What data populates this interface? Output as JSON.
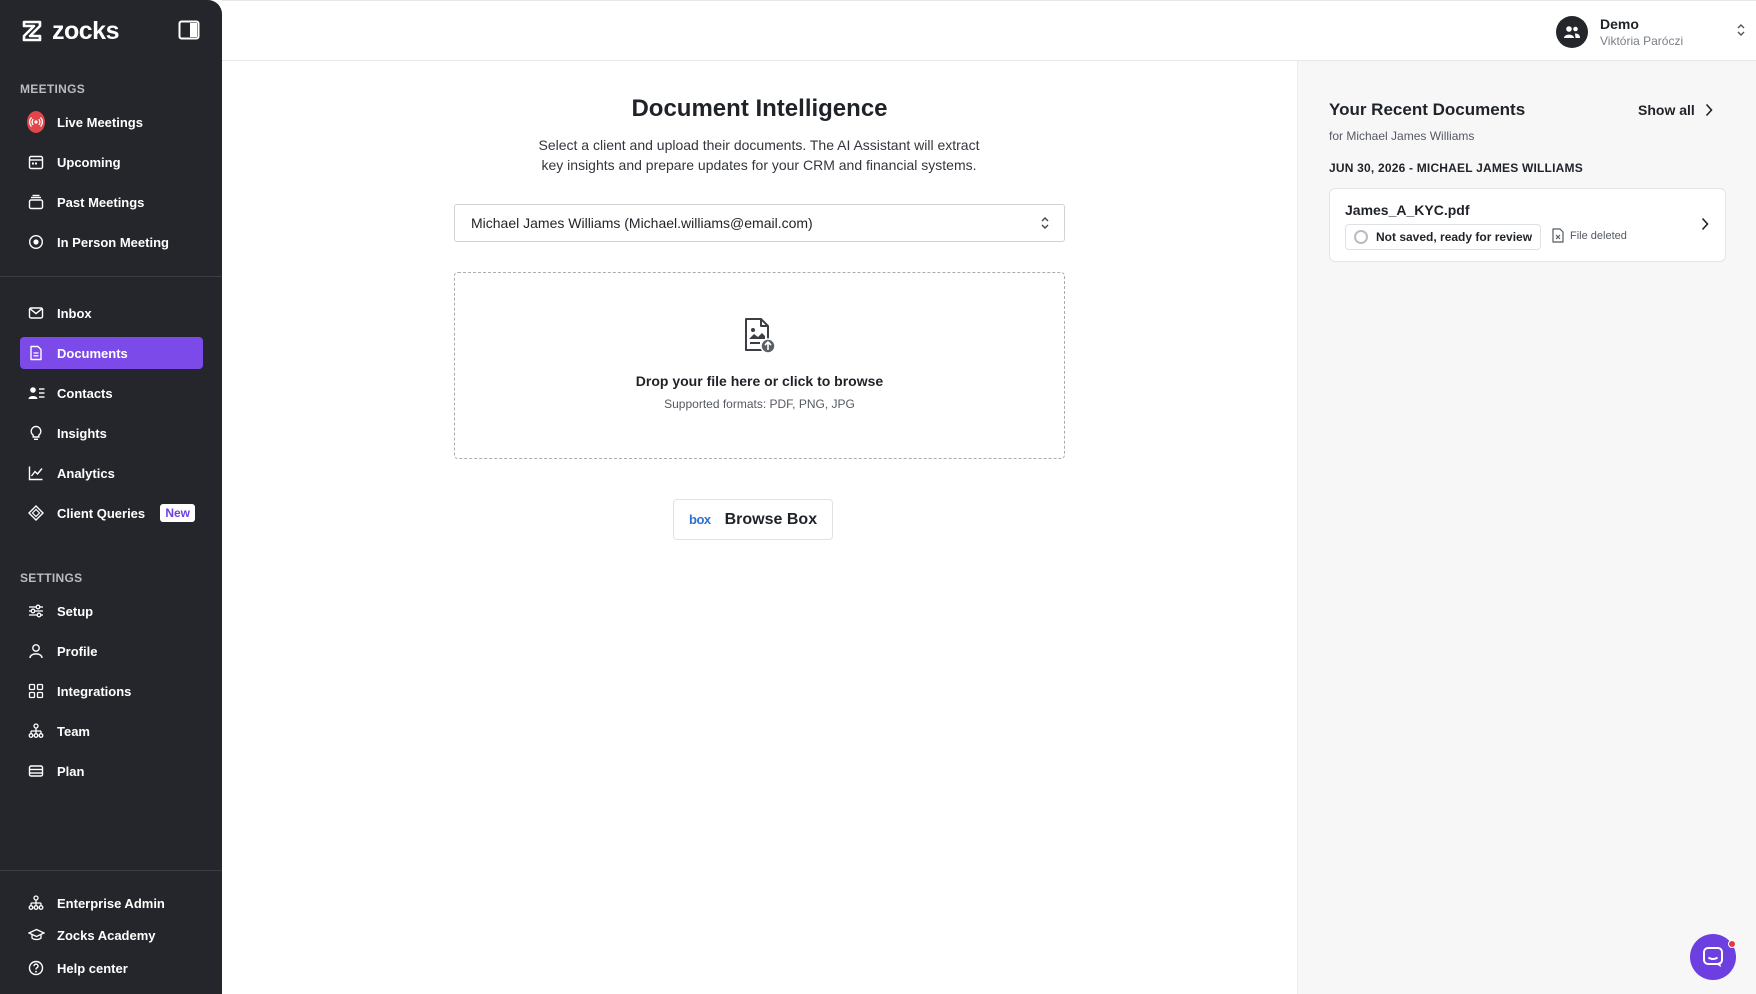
{
  "brand": {
    "name": "zocks"
  },
  "sidebar": {
    "meetings_label": "MEETINGS",
    "settings_label": "SETTINGS",
    "meetings": [
      {
        "label": "Live Meetings",
        "icon": "broadcast-icon"
      },
      {
        "label": "Upcoming",
        "icon": "calendar-icon"
      },
      {
        "label": "Past Meetings",
        "icon": "archive-icon"
      },
      {
        "label": "In Person Meeting",
        "icon": "record-icon"
      }
    ],
    "main": [
      {
        "label": "Inbox",
        "icon": "mail-icon"
      },
      {
        "label": "Documents",
        "icon": "document-icon",
        "active": true
      },
      {
        "label": "Contacts",
        "icon": "contacts-icon"
      },
      {
        "label": "Insights",
        "icon": "lightbulb-icon"
      },
      {
        "label": "Analytics",
        "icon": "chart-icon"
      },
      {
        "label": "Client Queries",
        "icon": "diamond-icon",
        "badge": "New"
      }
    ],
    "settings": [
      {
        "label": "Setup",
        "icon": "sliders-icon"
      },
      {
        "label": "Profile",
        "icon": "user-icon"
      },
      {
        "label": "Integrations",
        "icon": "grid-icon"
      },
      {
        "label": "Team",
        "icon": "team-icon"
      },
      {
        "label": "Plan",
        "icon": "card-icon"
      }
    ],
    "footer": [
      {
        "label": "Enterprise Admin",
        "icon": "hierarchy-icon"
      },
      {
        "label": "Zocks Academy",
        "icon": "graduation-icon"
      },
      {
        "label": "Help center",
        "icon": "help-icon"
      }
    ]
  },
  "user": {
    "org": "Demo",
    "name": "Viktória Paróczi"
  },
  "main": {
    "title": "Document Intelligence",
    "subtitle": "Select a client and upload their documents. The AI Assistant will extract key insights and prepare updates for your CRM and financial systems.",
    "client_select": "Michael James Williams (Michael.williams@email.com)",
    "dropzone": {
      "title": "Drop your file here or click to browse",
      "formats": "Supported formats: PDF, PNG, JPG"
    },
    "browse_box": {
      "logo": "box",
      "label": "Browse Box"
    }
  },
  "recent": {
    "title": "Your Recent Documents",
    "show_all": "Show all",
    "for": "for Michael James Williams",
    "date_header": "JUN 30, 2026 - MICHAEL JAMES WILLIAMS",
    "documents": [
      {
        "name": "James_A_KYC.pdf",
        "status": "Not saved, ready for review",
        "file_state": "File deleted"
      }
    ]
  },
  "colors": {
    "sidebar_bg": "#24262b",
    "accent": "#7c4ae8",
    "live": "#e0464a"
  }
}
